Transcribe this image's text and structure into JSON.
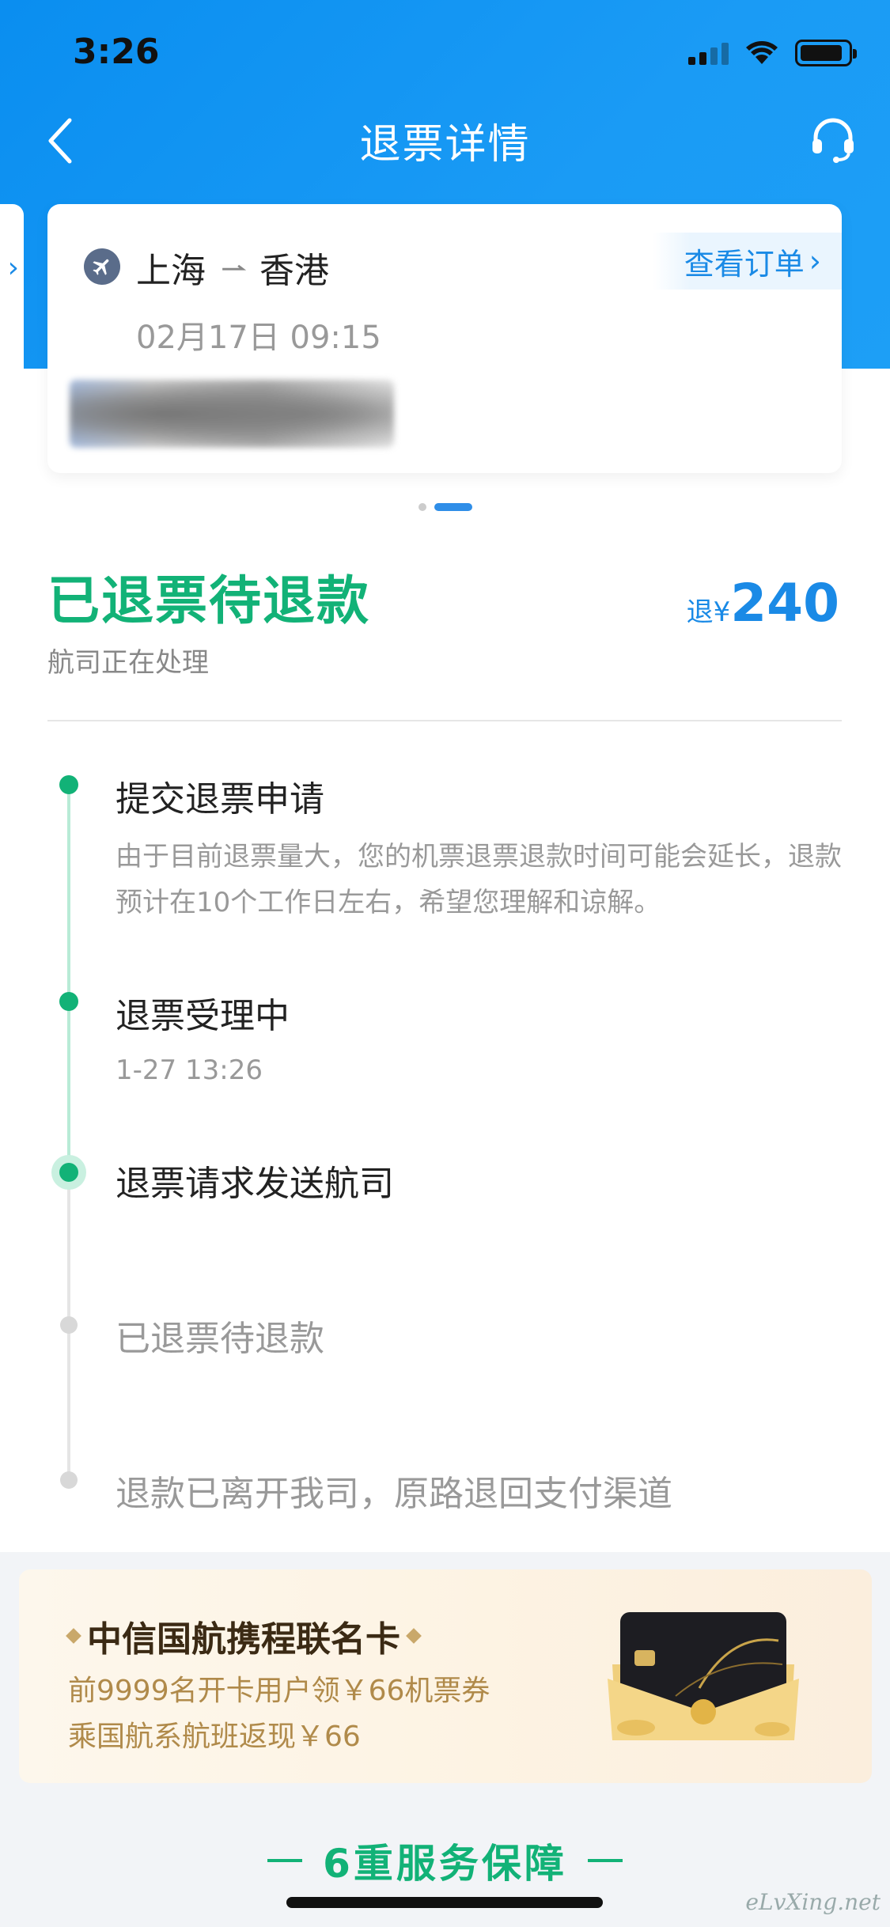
{
  "status_bar": {
    "time": "3:26"
  },
  "nav": {
    "title": "退票详情"
  },
  "flight": {
    "origin": "上海",
    "destination": "香港",
    "datetime": "02月17日 09:15",
    "order_link": "查看订单"
  },
  "pager": {
    "count": 2,
    "active": 2
  },
  "refund_status": {
    "title": "已退票待退款",
    "subtitle": "航司正在处理",
    "amount_label": "退¥",
    "amount": "240"
  },
  "timeline": [
    {
      "title": "提交退票申请",
      "desc": "由于目前退票量大，您的机票退票退款时间可能会延长，退款预计在10个工作日左右，希望您理解和谅解。",
      "state": "done"
    },
    {
      "title": "退票受理中",
      "desc": "1-27 13:26",
      "state": "done"
    },
    {
      "title": "退票请求发送航司",
      "desc": "",
      "state": "current"
    },
    {
      "title": "已退票待退款",
      "desc": "",
      "state": "pending"
    },
    {
      "title": "退款已离开我司，原路退回支付渠道",
      "desc": "",
      "state": "pending"
    }
  ],
  "promo": {
    "title": "中信国航携程联名卡",
    "line1": "前9999名开卡用户领￥66机票券",
    "line2": "乘国航系航班返现￥66"
  },
  "guarantee": {
    "title": "6重服务保障"
  },
  "watermark": "eLvXing.net",
  "colors": {
    "brand_blue": "#1a9bf5",
    "status_green": "#12b277",
    "link_blue": "#1a8ae6"
  }
}
